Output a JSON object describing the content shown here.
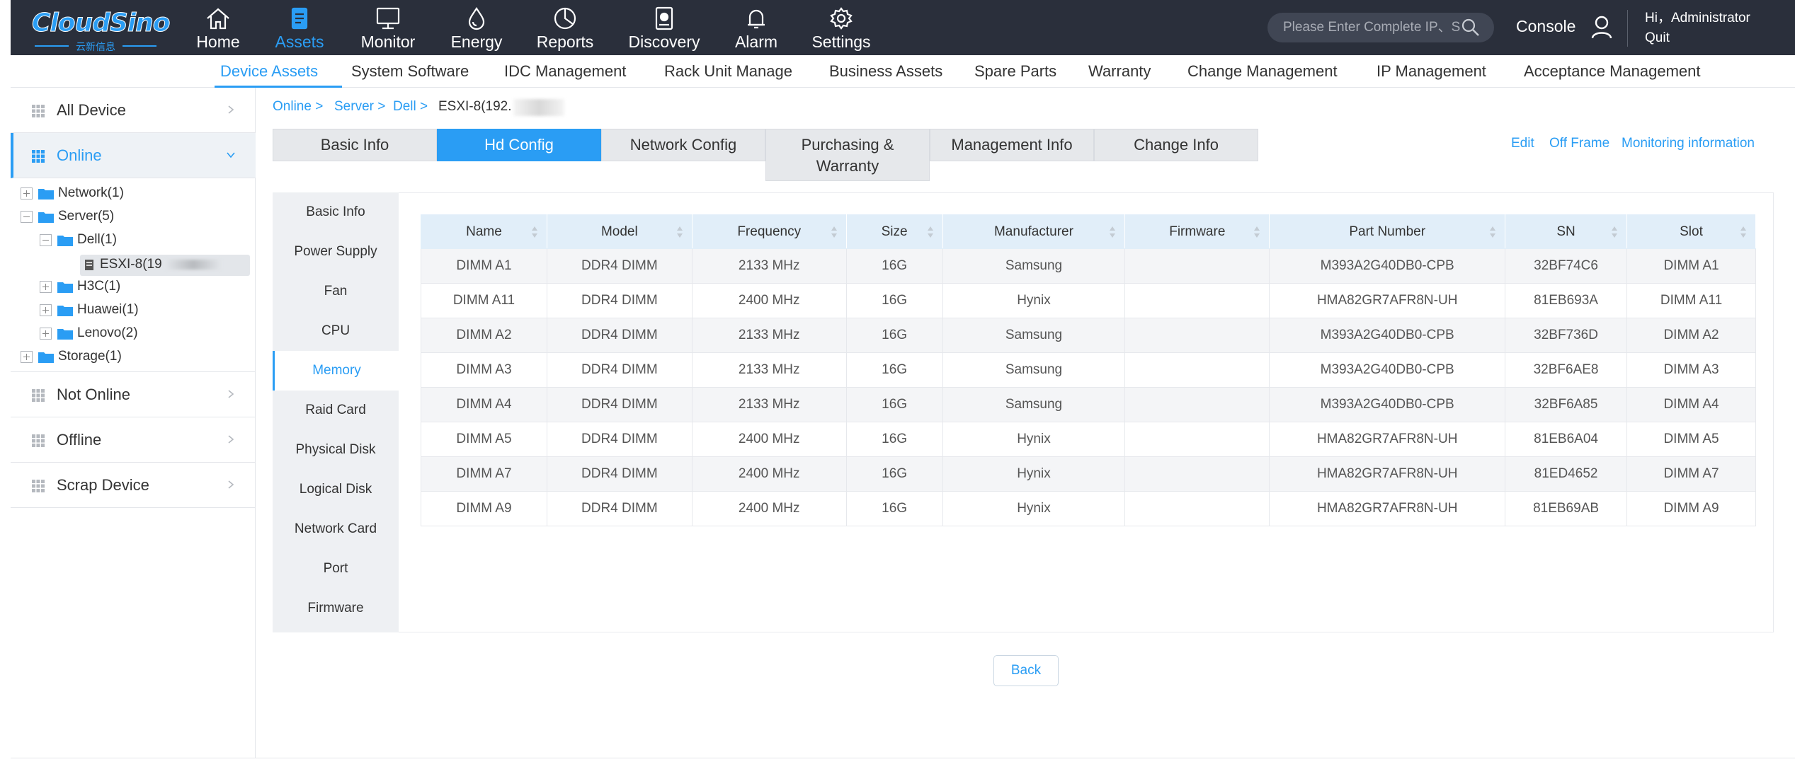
{
  "brand": {
    "name": "CloudSino",
    "sub": "云新信息",
    "color": "#2a9df4"
  },
  "topnav": [
    {
      "label": "Home",
      "icon": "home-icon"
    },
    {
      "label": "Assets",
      "icon": "clipboard-icon",
      "active": true
    },
    {
      "label": "Monitor",
      "icon": "monitor-icon"
    },
    {
      "label": "Energy",
      "icon": "drop-icon"
    },
    {
      "label": "Reports",
      "icon": "pie-icon"
    },
    {
      "label": "Discovery",
      "icon": "discovery-icon"
    },
    {
      "label": "Alarm",
      "icon": "bell-icon"
    },
    {
      "label": "Settings",
      "icon": "gear-icon"
    }
  ],
  "search": {
    "placeholder": "Please Enter Complete IP、S"
  },
  "header": {
    "console": "Console",
    "greeting": "Hi，Administrator",
    "quit": "Quit"
  },
  "subnav": [
    "Device Assets",
    "System Software",
    "IDC Management",
    "Rack Unit Manage",
    "Business Assets",
    "Spare Parts",
    "Warranty",
    "Change Management",
    "IP Management",
    "Acceptance Management"
  ],
  "sidebar": {
    "all_device": "All Device",
    "online": "Online",
    "not_online": "Not Online",
    "offline": "Offline",
    "scrap": "Scrap Device",
    "tree": [
      "Network(1)",
      "Server(5)",
      "Dell(1)",
      "ESXI-8(19",
      "H3C(1)",
      "Huawei(1)",
      "Lenovo(2)",
      "Storage(1)"
    ]
  },
  "breadcrumb": [
    "Online >",
    "Server >",
    "Dell >",
    "ESXI-8(192."
  ],
  "tabs": [
    "Basic Info",
    "Hd Config",
    "Network Config",
    "Purchasing &",
    "Warranty",
    "Management Info",
    "Change Info"
  ],
  "actions": [
    "Edit",
    "Off Frame",
    "Monitoring information"
  ],
  "vtabs": [
    "Basic Info",
    "Power Supply",
    "Fan",
    "CPU",
    "Memory",
    "Raid Card",
    "Physical Disk",
    "Logical Disk",
    "Network Card",
    "Port",
    "Firmware"
  ],
  "table": {
    "columns": [
      "Name",
      "Model",
      "Frequency",
      "Size",
      "Manufacturer",
      "Firmware",
      "Part Number",
      "SN",
      "Slot"
    ],
    "rows": [
      [
        "DIMM A1",
        "DDR4 DIMM",
        "2133 MHz",
        "16G",
        "Samsung",
        "",
        "M393A2G40DB0-CPB",
        "32BF74C6",
        "DIMM A1"
      ],
      [
        "DIMM A11",
        "DDR4 DIMM",
        "2400 MHz",
        "16G",
        "Hynix",
        "",
        "HMA82GR7AFR8N-UH",
        "81EB693A",
        "DIMM A11"
      ],
      [
        "DIMM A2",
        "DDR4 DIMM",
        "2133 MHz",
        "16G",
        "Samsung",
        "",
        "M393A2G40DB0-CPB",
        "32BF736D",
        "DIMM A2"
      ],
      [
        "DIMM A3",
        "DDR4 DIMM",
        "2133 MHz",
        "16G",
        "Samsung",
        "",
        "M393A2G40DB0-CPB",
        "32BF6AE8",
        "DIMM A3"
      ],
      [
        "DIMM A4",
        "DDR4 DIMM",
        "2133 MHz",
        "16G",
        "Samsung",
        "",
        "M393A2G40DB0-CPB",
        "32BF6A85",
        "DIMM A4"
      ],
      [
        "DIMM A5",
        "DDR4 DIMM",
        "2400 MHz",
        "16G",
        "Hynix",
        "",
        "HMA82GR7AFR8N-UH",
        "81EB6A04",
        "DIMM A5"
      ],
      [
        "DIMM A7",
        "DDR4 DIMM",
        "2400 MHz",
        "16G",
        "Hynix",
        "",
        "HMA82GR7AFR8N-UH",
        "81ED4652",
        "DIMM A7"
      ],
      [
        "DIMM A9",
        "DDR4 DIMM",
        "2400 MHz",
        "16G",
        "Hynix",
        "",
        "HMA82GR7AFR8N-UH",
        "81EB69AB",
        "DIMM A9"
      ]
    ]
  },
  "back_label": "Back"
}
